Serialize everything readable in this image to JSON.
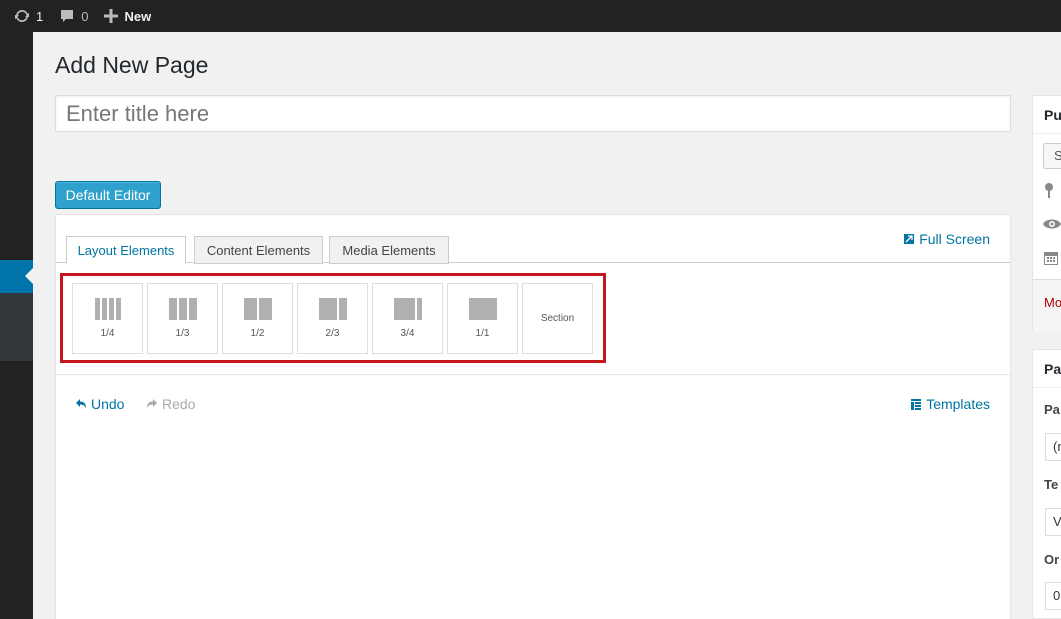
{
  "adminbar": {
    "updates_count": "1",
    "comments_count": "0",
    "new_label": "New"
  },
  "page": {
    "title": "Add New Page",
    "title_placeholder": "Enter title here",
    "default_editor_label": "Default Editor"
  },
  "builder": {
    "tabs": [
      {
        "label": "Layout Elements",
        "active": true
      },
      {
        "label": "Content Elements",
        "active": false
      },
      {
        "label": "Media Elements",
        "active": false
      }
    ],
    "fullscreen_label": "Full Screen",
    "elements": [
      {
        "label": "1/4"
      },
      {
        "label": "1/3"
      },
      {
        "label": "1/2"
      },
      {
        "label": "2/3"
      },
      {
        "label": "3/4"
      },
      {
        "label": "1/1"
      },
      {
        "label": "Section"
      }
    ],
    "undo_label": "Undo",
    "redo_label": "Redo",
    "templates_label": "Templates"
  },
  "sidebar": {
    "publish_head": "Pu",
    "save_btn": "S",
    "move_link": "Mo",
    "attributes_head": "Pa",
    "parent_label": "Pa",
    "parent_value": "(n",
    "template_label": "Te",
    "template_value": "V",
    "order_label": "Or",
    "order_value": "0"
  },
  "colors": {
    "accent": "#0074a2",
    "button": "#2ea2cc",
    "highlight": "#c4161c",
    "adminbar": "#222222"
  }
}
